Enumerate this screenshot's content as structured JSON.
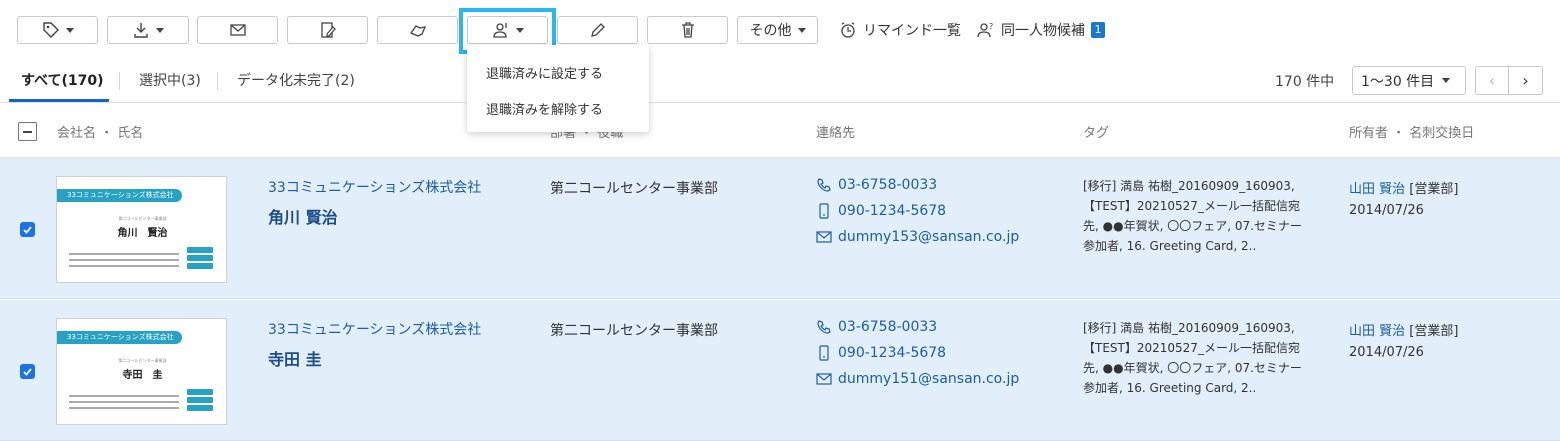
{
  "toolbar": {
    "more_label": "その他",
    "remind_label": "リマインド一覧",
    "same_person_label": "同一人物候補",
    "same_person_badge": "1"
  },
  "dropdown": {
    "items": [
      "退職済みに設定する",
      "退職済みを解除する"
    ]
  },
  "tabs": [
    {
      "label": "すべて(170)"
    },
    {
      "label": "選択中(3)"
    },
    {
      "label": "データ化未完了(2)"
    }
  ],
  "pagination": {
    "count_text": "170 件中",
    "per_page": "1〜30 件目",
    "prev": "‹",
    "next": "›"
  },
  "columns": {
    "name": "会社名 ・ 氏名",
    "dept": "部署 ・ 役職",
    "contact": "連絡先",
    "tag": "タグ",
    "owner": "所有者 ・ 名刺交換日"
  },
  "rows": [
    {
      "card_company": "33コミュニケーションズ株式会社",
      "card_name": "角川　賢治",
      "card_dept": "第二コールセンター事業部",
      "company": "33コミュニケーションズ株式会社",
      "name": "角川 賢治",
      "dept": "第二コールセンター事業部",
      "phone": "03-6758-0033",
      "mobile": "090-1234-5678",
      "email": "dummy153@sansan.co.jp",
      "tags": "[移行] 満島 祐樹_20160909_160903, 【TEST】20210527_メール一括配信宛先, ●●年賀状, 〇〇フェア, 07.セミナー参加者, 16. Greeting Card, 2..",
      "owner_name": "山田 賢治",
      "owner_dept": "[営業部]",
      "date": "2014/07/26"
    },
    {
      "card_company": "33コミュニケーションズ株式会社",
      "card_name": "寺田　圭",
      "card_dept": "第二コールセンター事業部",
      "company": "33コミュニケーションズ株式会社",
      "name": "寺田 圭",
      "dept": "第二コールセンター事業部",
      "phone": "03-6758-0033",
      "mobile": "090-1234-5678",
      "email": "dummy151@sansan.co.jp",
      "tags": "[移行] 満島 祐樹_20160909_160903, 【TEST】20210527_メール一括配信宛先, ●●年賀状, 〇〇フェア, 07.セミナー参加者, 16. Greeting Card, 2..",
      "owner_name": "山田 賢治",
      "owner_dept": "[営業部]",
      "date": "2014/07/26"
    }
  ],
  "colors": {
    "accent": "#1565c0",
    "highlight": "#29b6f6",
    "row_selected": "#e3eefb",
    "link": "#1a5ea8"
  }
}
